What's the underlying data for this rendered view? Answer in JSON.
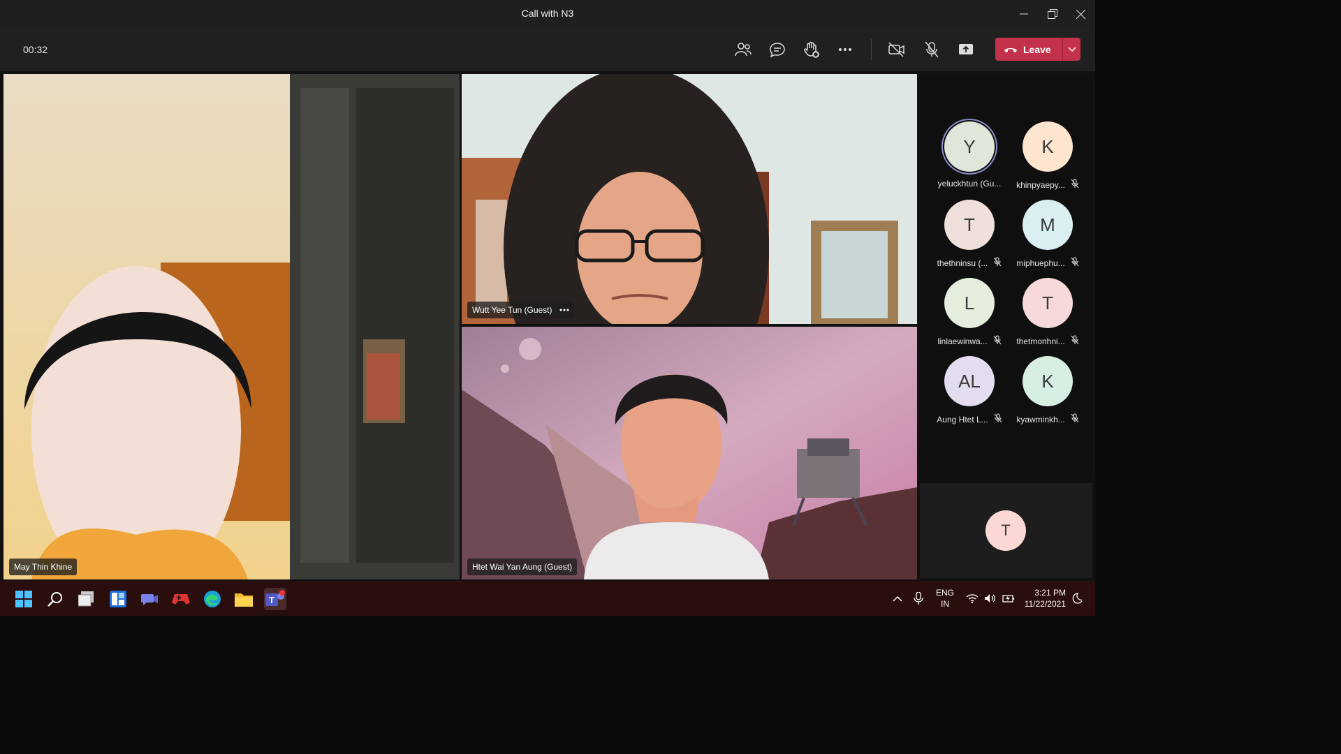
{
  "window": {
    "title": "Call with N3"
  },
  "toolbar": {
    "timer": "00:32",
    "leave_label": "Leave"
  },
  "videos": [
    {
      "name": "May Thin Khine"
    },
    {
      "name": "Wutt Yee Tun (Guest)"
    },
    {
      "name": "Htet Wai Yan Aung (Guest)"
    }
  ],
  "roster": [
    {
      "initials": "Y",
      "name": "yeluckhtun (Gu...",
      "color": "#dfe6da",
      "speaking": true,
      "muted": false
    },
    {
      "initials": "K",
      "name": "khinpyaepy...",
      "color": "#fde5cf",
      "speaking": false,
      "muted": true
    },
    {
      "initials": "T",
      "name": "thethninsu (...",
      "color": "#efe0dc",
      "speaking": false,
      "muted": true
    },
    {
      "initials": "M",
      "name": "miphuephu...",
      "color": "#dbeff3",
      "speaking": false,
      "muted": true
    },
    {
      "initials": "L",
      "name": "linlaewinwa...",
      "color": "#e5eedc",
      "speaking": false,
      "muted": true
    },
    {
      "initials": "T",
      "name": "thetmonhni...",
      "color": "#f8d9db",
      "speaking": false,
      "muted": true
    },
    {
      "initials": "AL",
      "name": "Aung Htet L...",
      "color": "#e3ddef",
      "speaking": false,
      "muted": true
    },
    {
      "initials": "K",
      "name": "kyawminkh...",
      "color": "#d6efe2",
      "speaking": false,
      "muted": true
    }
  ],
  "self": {
    "initials": "T",
    "color": "#fbd8d3"
  },
  "taskbar": {
    "language": "ENG",
    "region": "IN",
    "time": "3:21 PM",
    "date": "11/22/2021"
  }
}
